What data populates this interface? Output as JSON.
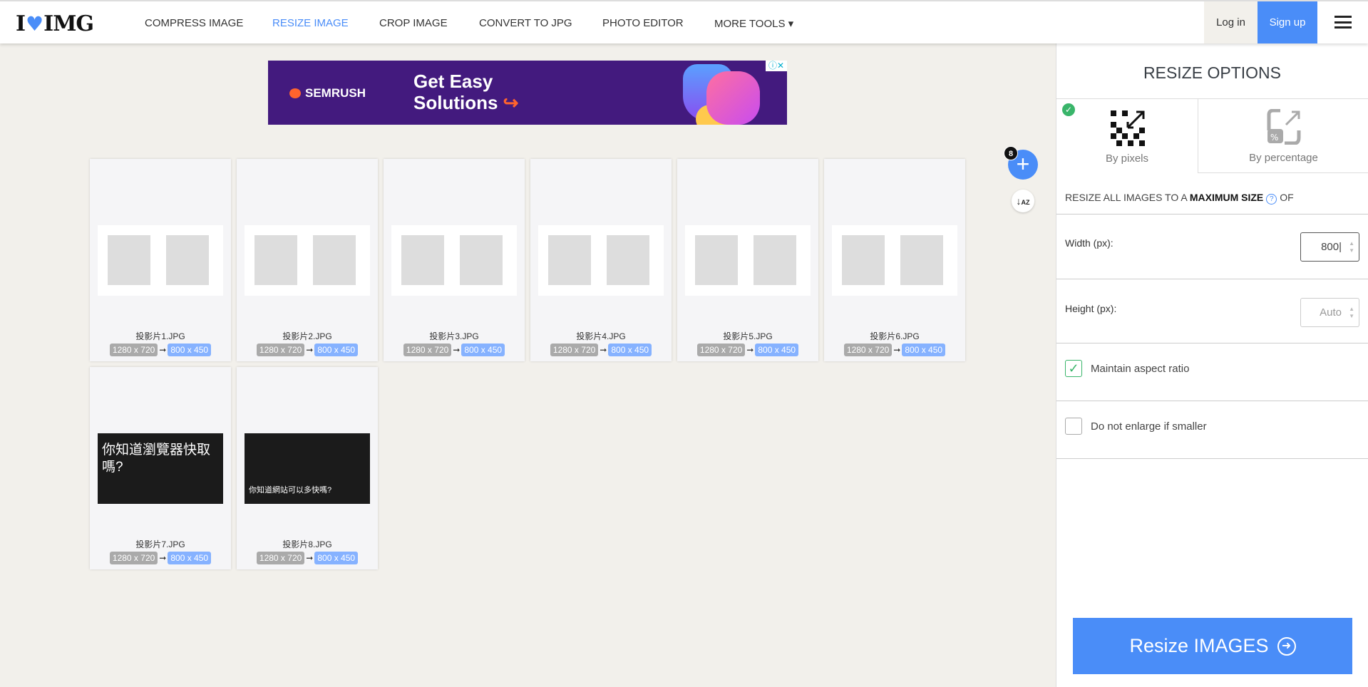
{
  "header": {
    "logo": "I♥IMG",
    "logo_left": "I",
    "logo_right": "IMG",
    "nav": [
      {
        "label": "COMPRESS IMAGE"
      },
      {
        "label": "RESIZE IMAGE",
        "active": true
      },
      {
        "label": "CROP IMAGE"
      },
      {
        "label": "CONVERT TO JPG"
      },
      {
        "label": "PHOTO EDITOR"
      },
      {
        "label": "MORE TOOLS ▾"
      }
    ],
    "login": "Log in",
    "signup": "Sign up"
  },
  "ad": {
    "brand": "SEMRUSH",
    "line1": "Get Easy",
    "line2": "Solutions",
    "arrow": "↪"
  },
  "files": [
    {
      "name": "投影片1.JPG",
      "from": "1280 x 720",
      "to": "800 x 450"
    },
    {
      "name": "投影片2.JPG",
      "from": "1280 x 720",
      "to": "800 x 450"
    },
    {
      "name": "投影片3.JPG",
      "from": "1280 x 720",
      "to": "800 x 450"
    },
    {
      "name": "投影片4.JPG",
      "from": "1280 x 720",
      "to": "800 x 450"
    },
    {
      "name": "投影片5.JPG",
      "from": "1280 x 720",
      "to": "800 x 450"
    },
    {
      "name": "投影片6.JPG",
      "from": "1280 x 720",
      "to": "800 x 450"
    },
    {
      "name": "投影片7.JPG",
      "from": "1280 x 720",
      "to": "800 x 450",
      "thumb_text": "你知道瀏覽器快取嗎?"
    },
    {
      "name": "投影片8.JPG",
      "from": "1280 x 720",
      "to": "800 x 450",
      "thumb_text": "你知道網站可以多快嗎?"
    }
  ],
  "file_count": "8",
  "sidebar": {
    "title": "RESIZE OPTIONS",
    "tab_pixels": "By pixels",
    "tab_percentage": "By percentage",
    "max_pre": "RESIZE ALL IMAGES TO A",
    "max_bold": "MAXIMUM SIZE",
    "max_post": "OF",
    "width_label": "Width (px):",
    "width_value": "800",
    "height_label": "Height (px):",
    "height_placeholder": "Auto",
    "aspect_label": "Maintain aspect ratio",
    "aspect_checked": true,
    "enlarge_label": "Do not enlarge if smaller",
    "enlarge_checked": false,
    "submit": "Resize IMAGES"
  },
  "colors": {
    "accent": "#4a8df8",
    "check": "#39b56a",
    "ad_bg": "#431a7e"
  }
}
